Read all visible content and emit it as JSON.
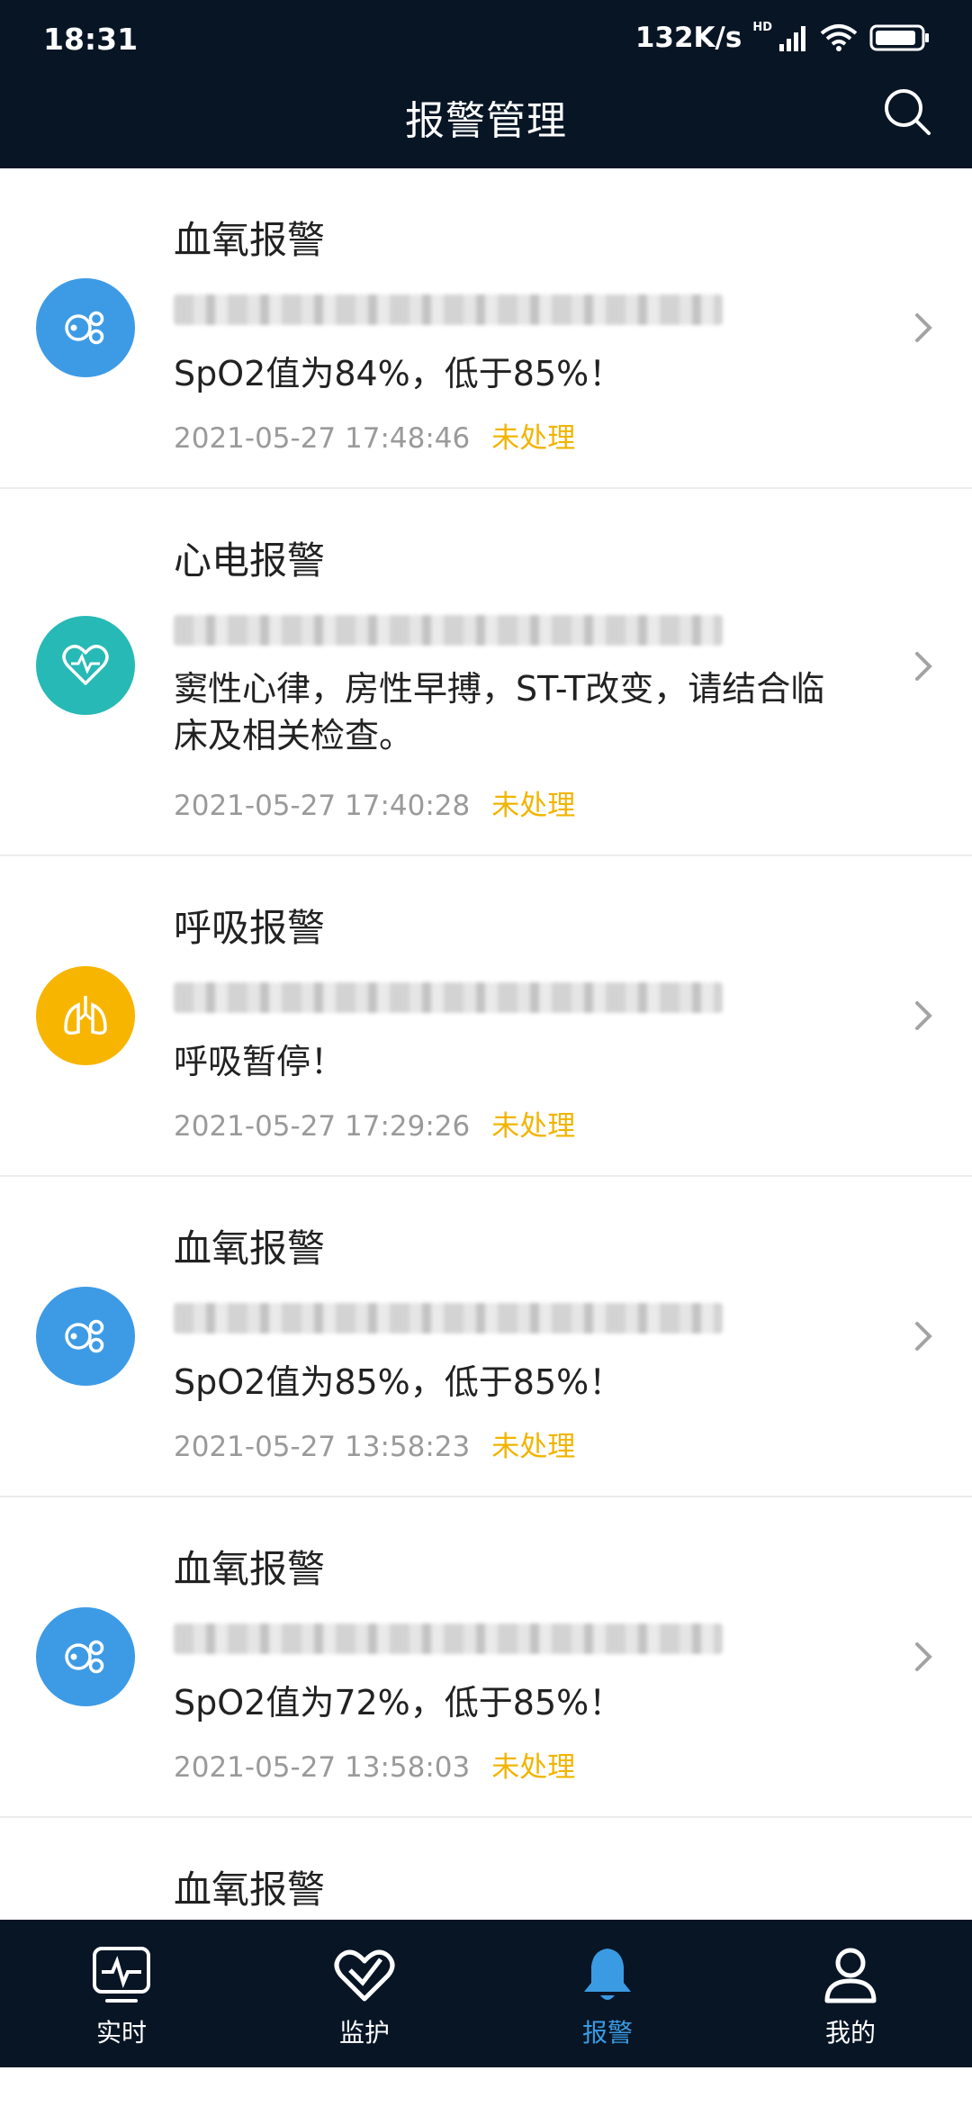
{
  "status": {
    "time": "18:31",
    "net_speed": "132K/s",
    "hd": "HD"
  },
  "header": {
    "title": "报警管理"
  },
  "alarms": [
    {
      "type": "血氧报警",
      "message": "SpO2值为84%，低于85%！",
      "time": "2021-05-27 17:48:46",
      "status": "未处理",
      "color": "#3d9be6",
      "icon": "spo2-icon"
    },
    {
      "type": "心电报警",
      "message": "窦性心律，房性早搏，ST-T改变，请结合临床及相关检查。",
      "time": "2021-05-27 17:40:28",
      "status": "未处理",
      "color": "#27b9b6",
      "icon": "heart-icon"
    },
    {
      "type": "呼吸报警",
      "message": "呼吸暂停！",
      "time": "2021-05-27 17:29:26",
      "status": "未处理",
      "color": "#f7b500",
      "icon": "lungs-icon"
    },
    {
      "type": "血氧报警",
      "message": "SpO2值为85%，低于85%！",
      "time": "2021-05-27 13:58:23",
      "status": "未处理",
      "color": "#3d9be6",
      "icon": "spo2-icon"
    },
    {
      "type": "血氧报警",
      "message": "SpO2值为72%，低于85%！",
      "time": "2021-05-27 13:58:03",
      "status": "未处理",
      "color": "#3d9be6",
      "icon": "spo2-icon"
    },
    {
      "type": "血氧报警"
    }
  ],
  "nav": [
    {
      "label": "实时",
      "icon": "realtime-monitor-icon",
      "active": false
    },
    {
      "label": "监护",
      "icon": "heart-outline-icon",
      "active": false
    },
    {
      "label": "报警",
      "icon": "bell-icon",
      "active": true
    },
    {
      "label": "我的",
      "icon": "user-icon",
      "active": false
    }
  ],
  "colors": {
    "header_bg": "#081525",
    "accent": "#3a9be3",
    "status_pending": "#f1b400"
  }
}
